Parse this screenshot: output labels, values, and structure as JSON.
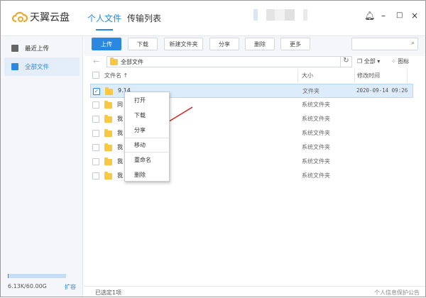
{
  "app": {
    "name": "天翼云盘"
  },
  "tabs": [
    {
      "label": "个人文件",
      "active": true
    },
    {
      "label": "传输列表",
      "active": false
    }
  ],
  "window_controls": {
    "bell": "bell-icon",
    "minimize": "–",
    "maximize": "□",
    "close": "×"
  },
  "sidebar": {
    "items": [
      {
        "label": "最近上传",
        "icon": "clock-icon"
      },
      {
        "label": "全部文件",
        "icon": "folder-icon",
        "active": true
      }
    ],
    "quota": {
      "text": "6.13K/60.00G",
      "used_fraction": 0.01,
      "expand": "扩容"
    }
  },
  "toolbar": {
    "upload": "上传",
    "download": "下载",
    "new_folder": "新建文件夹",
    "share": "分享",
    "delete": "删除",
    "more": "更多",
    "search_placeholder": ""
  },
  "path": {
    "current": "全部文件",
    "filter": "全部",
    "view": "图标"
  },
  "table": {
    "headers": {
      "name": "文件名",
      "size": "大小",
      "modified": "修改时间"
    },
    "rows": [
      {
        "name": "9.14",
        "size": "文件夹",
        "modified": "2020-09-14 09:26",
        "selected": true
      },
      {
        "name": "同",
        "size": "系统文件夹",
        "modified": ""
      },
      {
        "name": "我",
        "size": "系统文件夹",
        "modified": ""
      },
      {
        "name": "我",
        "size": "系统文件夹",
        "modified": ""
      },
      {
        "name": "我",
        "size": "系统文件夹",
        "modified": ""
      },
      {
        "name": "我",
        "size": "系统文件夹",
        "modified": ""
      },
      {
        "name": "我",
        "size": "系统文件夹",
        "modified": ""
      }
    ]
  },
  "context_menu": {
    "items": [
      "打开",
      "下载",
      "分享",
      "移动",
      "重命名",
      "删除"
    ]
  },
  "status": {
    "selected": "已选定1项",
    "notice": "个人信息保护公告"
  },
  "colors": {
    "accent": "#2b88e0",
    "logo": "#f5a623",
    "arrow": "#e02020",
    "selected_row": "#dcecfa"
  }
}
